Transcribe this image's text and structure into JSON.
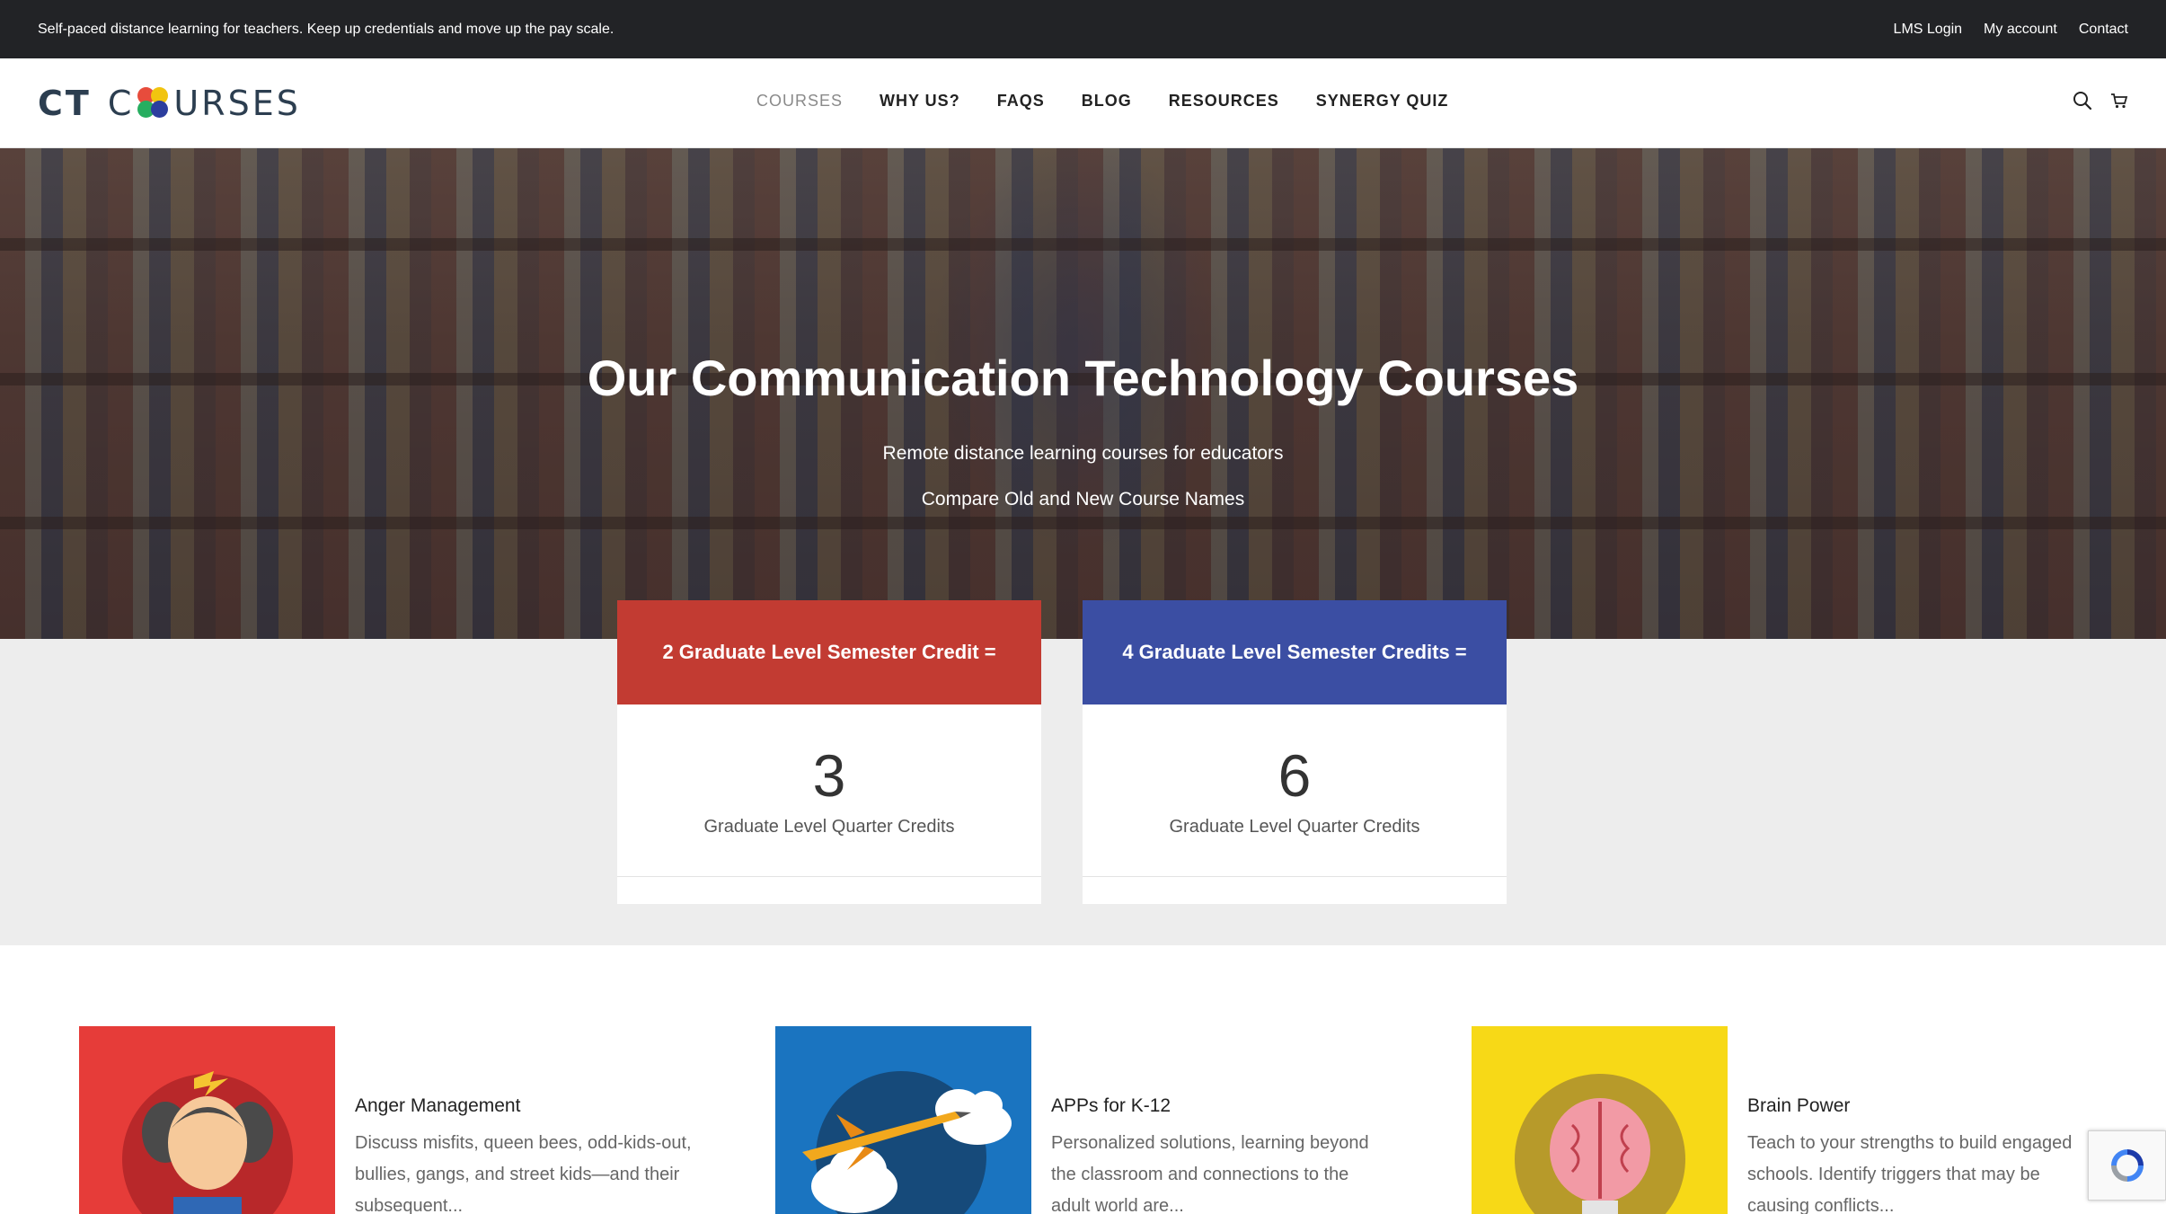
{
  "topbar": {
    "tagline": "Self-paced distance learning for teachers. Keep up credentials and move up the pay scale.",
    "links": [
      "LMS Login",
      "My account",
      "Contact"
    ]
  },
  "header": {
    "logo_left": "CT",
    "logo_c": "C",
    "logo_rest": "URSES",
    "nav": [
      "COURSES",
      "WHY US?",
      "FAQS",
      "BLOG",
      "RESOURCES",
      "SYNERGY QUIZ"
    ],
    "icons": [
      "search-icon",
      "cart-icon"
    ]
  },
  "hero": {
    "title": "Our Communication Technology Courses",
    "subtitle": "Remote distance learning courses for educators",
    "compare_link": "Compare Old and New Course Names"
  },
  "credits": [
    {
      "header": "2 Graduate Level Semester Credit =",
      "number": "3",
      "label": "Graduate Level Quarter Credits",
      "color": "#c23b32"
    },
    {
      "header": "4 Graduate Level Semester Credits =",
      "number": "6",
      "label": "Graduate Level Quarter Credits",
      "color": "#3b4ea3"
    }
  ],
  "courses": [
    {
      "title": "Anger Management",
      "desc": "Discuss misfits, queen bees, odd-kids-out, bullies, gangs, and street kids—and their subsequent...",
      "bg": "#e63c39",
      "icon": "angry-girl-icon"
    },
    {
      "title": "APPs for K-12",
      "desc": "Personalized solutions, learning beyond the classroom and connections to the adult world are...",
      "bg": "#1a74c0",
      "icon": "paper-plane-icon"
    },
    {
      "title": "Brain Power",
      "desc": "Teach to your strengths to build engaged schools. Identify triggers that may be causing conflicts...",
      "bg": "#f7d917",
      "icon": "brain-lightbulb-icon"
    }
  ]
}
